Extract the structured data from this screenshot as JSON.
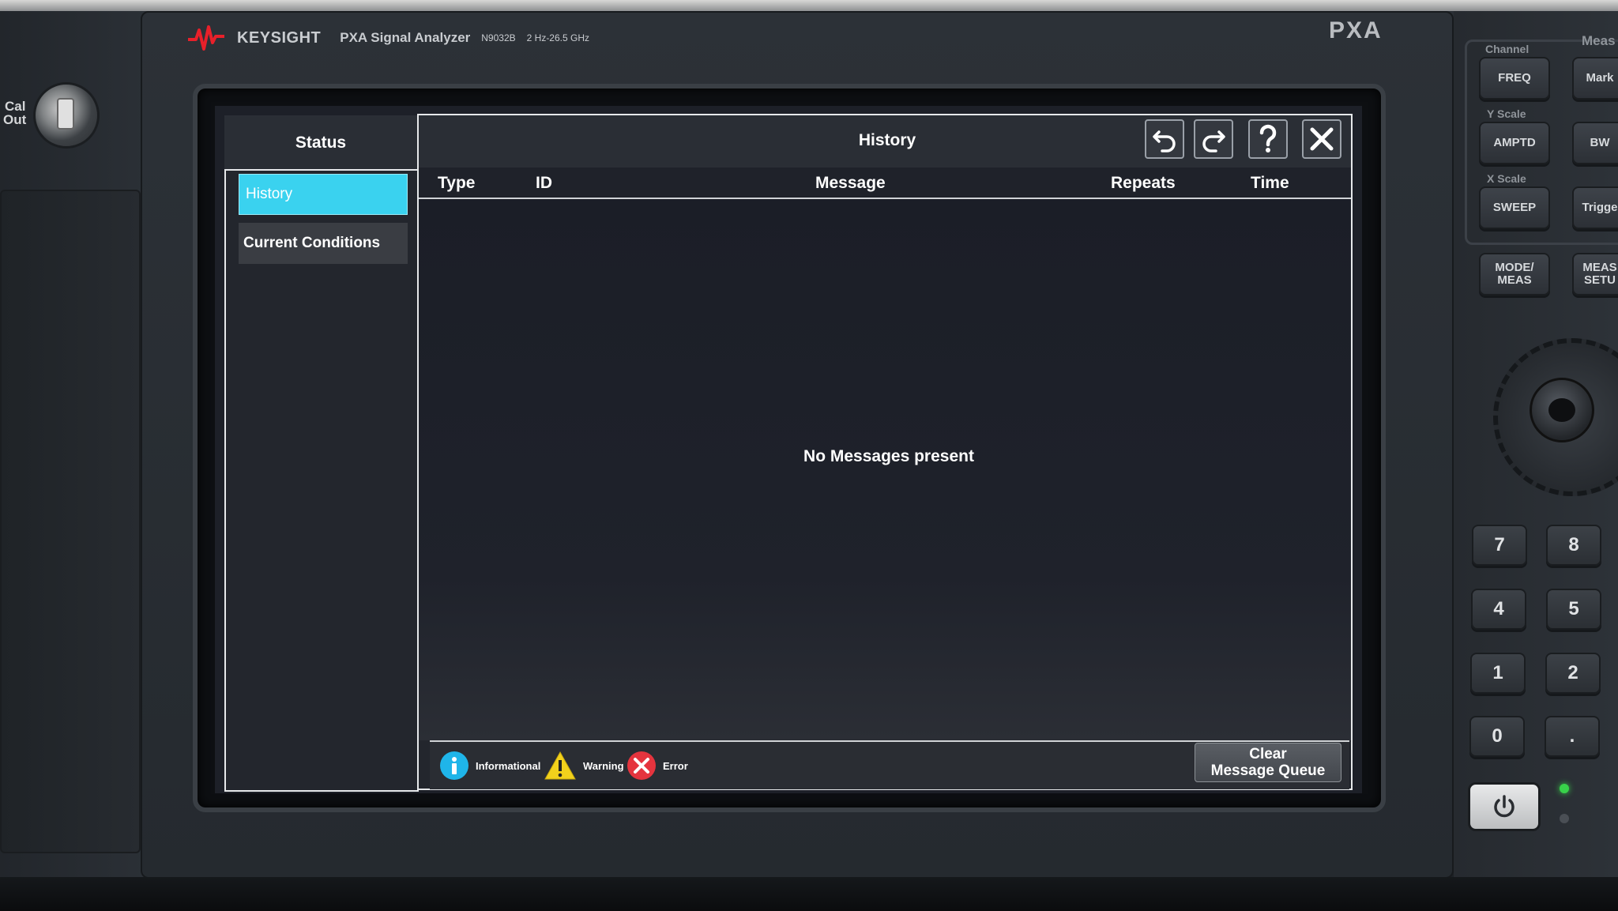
{
  "brand": {
    "name": "KEYSIGHT",
    "model": "PXA Signal Analyzer",
    "model_number": "N9032B",
    "freq_range": "2 Hz-26.5 GHz",
    "badge": "PXA",
    "logo_color": "#e8202a"
  },
  "cal_out": {
    "line1": "Cal",
    "line2": "Out"
  },
  "status_panel": {
    "header": "Status",
    "nav": [
      {
        "label": "History",
        "selected": true
      },
      {
        "label": "Current Conditions",
        "selected": false
      }
    ]
  },
  "history_panel": {
    "title": "History",
    "toolbar": {
      "undo": "undo-icon",
      "redo": "redo-icon",
      "help": "help-icon",
      "close": "close-icon"
    },
    "columns": [
      "Type",
      "ID",
      "Message",
      "Repeats",
      "Time"
    ],
    "empty_text": "No Messages present",
    "legend": [
      {
        "label": "Informational",
        "icon": "info-icon",
        "color": "#1fb5e9"
      },
      {
        "label": "Warning",
        "icon": "warning-icon",
        "color": "#f2d11c"
      },
      {
        "label": "Error",
        "icon": "error-icon",
        "color": "#e5343e"
      }
    ],
    "clear_button": {
      "line1": "Clear",
      "line2": "Message Queue"
    }
  },
  "hardware_keys": {
    "groups": {
      "channel": "Channel",
      "meas": "Meas",
      "y_scale": "Y Scale",
      "x_scale": "X Scale"
    },
    "keys": {
      "freq": "FREQ",
      "marker": "Mark",
      "amptd": "AMPTD",
      "bw": "BW",
      "sweep": "SWEEP",
      "trigger": "Trigge",
      "mode_meas_1": "MODE/",
      "mode_meas_2": "MEAS",
      "meas_setup_1": "MEAS",
      "meas_setup_2": "SETU"
    },
    "numpad": [
      "7",
      "8",
      "4",
      "5",
      "1",
      "2",
      "0",
      "."
    ]
  },
  "colors": {
    "selected_nav": "#3ad2ef",
    "screen_background": "#1d2028",
    "panel_header": "#2a2e35"
  }
}
